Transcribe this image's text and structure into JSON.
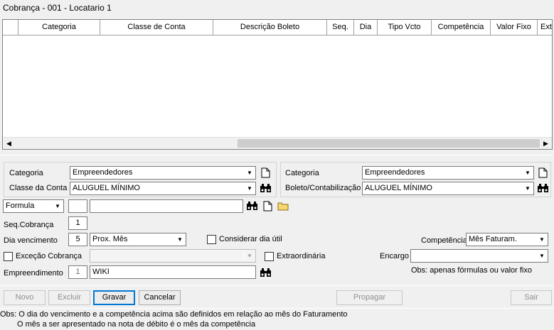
{
  "window": {
    "title": "Cobrança - 001 - Locatario 1"
  },
  "grid": {
    "columns": [
      "Categoria",
      "Classe de Conta",
      "Descrição Boleto",
      "Seq.",
      "Dia",
      "Tipo Vcto",
      "Competência",
      "Valor Fixo",
      "Ext"
    ],
    "rows": []
  },
  "left_group": {
    "categoria_label": "Categoria",
    "categoria_value": "Empreendedores",
    "classe_label": "Classe da Conta",
    "classe_value": "ALUGUEL MÍNIMO"
  },
  "right_group": {
    "categoria_label": "Categoria",
    "categoria_value": "Empreendedores",
    "boleto_label": "Boleto/Contabilização",
    "boleto_value": "ALUGUEL MÍNIMO"
  },
  "formula_row": {
    "type_value": "Formula",
    "code_value": "",
    "desc_value": ""
  },
  "seq": {
    "label": "Seq.Cobrança",
    "value": "1"
  },
  "dia": {
    "label": "Dia vencimento",
    "value": "5",
    "tipo_value": "Prox. Mês"
  },
  "considerar": {
    "label": "Considerar dia útil",
    "checked": false
  },
  "competencia": {
    "label": "Competência",
    "value": "Mês Faturam."
  },
  "excecao": {
    "label": "Exceção Cobrança",
    "checked": false,
    "value": ""
  },
  "extraordinaria": {
    "label": "Extraordinária",
    "checked": false
  },
  "encargo": {
    "label": "Encargo",
    "value": ""
  },
  "obs_right": "Obs: apenas fórmulas ou valor fixo",
  "empreendimento": {
    "label": "Empreendimento",
    "code": "1",
    "value": "WIKI"
  },
  "buttons": {
    "novo": "Novo",
    "excluir": "Excluir",
    "gravar": "Gravar",
    "cancelar": "Cancelar",
    "propagar": "Propagar",
    "sair": "Sair"
  },
  "footer": {
    "line1": "Obs: O dia do vencimento e a competência acima são definidos em relação ao mês do Faturamento",
    "line2": "O mês a ser apresentado na nota de débito é o mês da competência"
  },
  "icons": {
    "binoculars": "binoculars-icon",
    "page": "new-page-icon",
    "folder": "folder-icon",
    "dropdown": "chevron-down-icon"
  }
}
